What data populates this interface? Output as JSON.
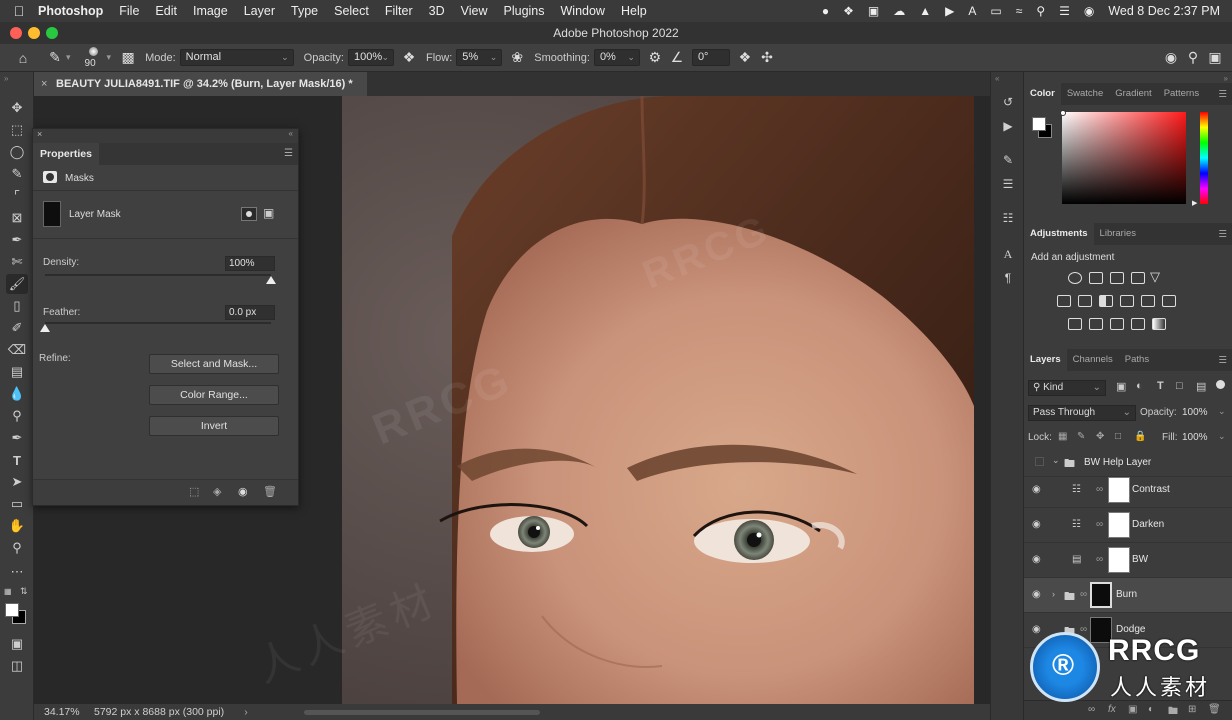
{
  "menubar": {
    "app_name": "Photoshop",
    "menus": [
      "File",
      "Edit",
      "Image",
      "Layer",
      "Type",
      "Select",
      "Filter",
      "3D",
      "View",
      "Plugins",
      "Window",
      "Help"
    ],
    "datetime": "Wed 8 Dec  2:37 PM"
  },
  "window": {
    "title": "Adobe Photoshop 2022"
  },
  "options": {
    "brush_size": "90",
    "mode_label": "Mode:",
    "mode_value": "Normal",
    "opacity_label": "Opacity:",
    "opacity_value": "100%",
    "flow_label": "Flow:",
    "flow_value": "5%",
    "smoothing_label": "Smoothing:",
    "smoothing_value": "0%",
    "angle_value": "0°"
  },
  "document": {
    "tab_title": "BEAUTY JULIA8491.TIF @ 34.2% (Burn, Layer Mask/16) *",
    "zoom": "34.17%",
    "info": "5792 px x 8688 px (300 ppi)"
  },
  "properties": {
    "tab": "Properties",
    "section": "Masks",
    "mask_name": "Layer Mask",
    "density_label": "Density:",
    "density_value": "100%",
    "feather_label": "Feather:",
    "feather_value": "0.0 px",
    "refine_label": "Refine:",
    "select_mask_btn": "Select and Mask...",
    "color_range_btn": "Color Range...",
    "invert_btn": "Invert"
  },
  "color_panel": {
    "tabs": [
      "Color",
      "Swatche",
      "Gradient",
      "Patterns"
    ]
  },
  "adjustments_panel": {
    "tabs": [
      "Adjustments",
      "Libraries"
    ],
    "hint": "Add an adjustment"
  },
  "layers_panel": {
    "tabs": [
      "Layers",
      "Channels",
      "Paths"
    ],
    "kind": "Kind",
    "blend_mode": "Pass Through",
    "opacity_label": "Opacity:",
    "opacity_value": "100%",
    "lock_label": "Lock:",
    "fill_label": "Fill:",
    "fill_value": "100%",
    "group_name": "BW Help Layer",
    "layers": [
      "Contrast",
      "Darken",
      "BW",
      "Burn",
      "Dodge"
    ]
  },
  "watermark": {
    "brand": "RRCG",
    "subtitle": "人人素材"
  },
  "colors": {
    "accent": "#1a74c8",
    "panel": "#3c3c3c"
  }
}
